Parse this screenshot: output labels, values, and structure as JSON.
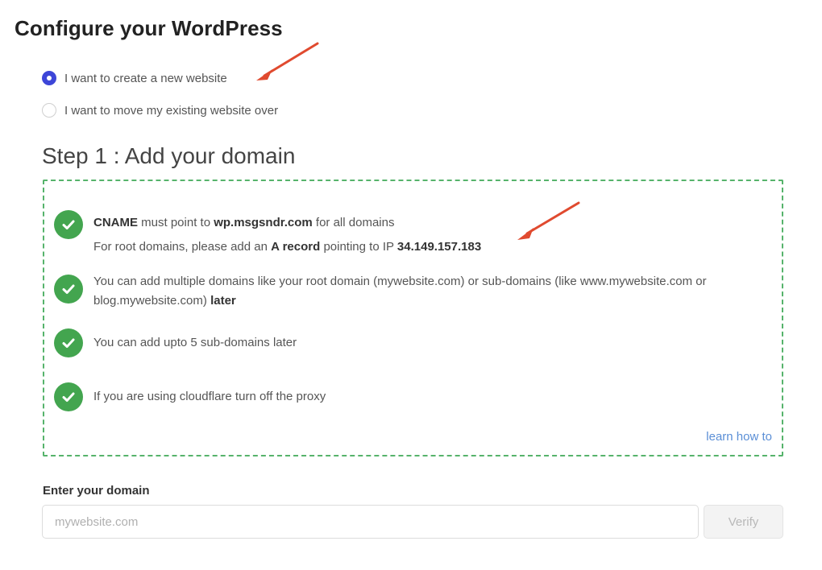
{
  "page": {
    "title": "Configure your WordPress"
  },
  "options": [
    {
      "label": "I want to create a new website",
      "checked": true
    },
    {
      "label": "I want to move my existing website over",
      "checked": false
    }
  ],
  "step": {
    "title": "Step 1 : Add your domain"
  },
  "info": {
    "item1": {
      "line1": {
        "b1": "CNAME",
        "t1": " must point to ",
        "b2": "wp.msgsndr.com",
        "t2": " for all domains"
      },
      "line2": {
        "t1": "For root domains, please add an ",
        "b1": "A record",
        "t2": " pointing to IP ",
        "b2": "34.149.157.183"
      }
    },
    "item2": {
      "t1": "You can add multiple domains like your root domain (mywebsite.com) or sub-domains (like www.mywebsite.com or blog.mywebsite.com) ",
      "b1": "later"
    },
    "item3": {
      "t1": "You can add upto 5 sub-domains later"
    },
    "item4": {
      "t1": "If you are using cloudflare turn off the proxy"
    },
    "learn_link": "learn how to"
  },
  "domain": {
    "label": "Enter your domain",
    "placeholder": "mywebsite.com",
    "value": "",
    "verify_label": "Verify"
  },
  "colors": {
    "accent": "#3d46d8",
    "success": "#43a54f",
    "link": "#5b8fd6",
    "annotation_arrow": "#e04a2f"
  },
  "icons": [
    "check-circle-icon",
    "annotation-arrow-icon"
  ]
}
